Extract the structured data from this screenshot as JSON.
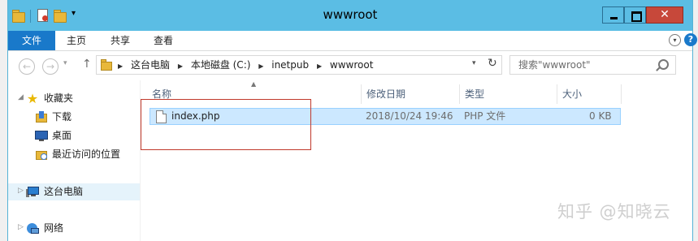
{
  "window": {
    "title": "wwwroot"
  },
  "ribbon": {
    "tabs": [
      {
        "label": "文件"
      },
      {
        "label": "主页"
      },
      {
        "label": "共享"
      },
      {
        "label": "查看"
      }
    ]
  },
  "address_bar": {
    "path": [
      "这台电脑",
      "本地磁盘 (C:)",
      "inetpub",
      "wwwroot"
    ]
  },
  "search": {
    "placeholder": "搜索\"wwwroot\""
  },
  "nav_pane": {
    "items": [
      {
        "label": "收藏夹",
        "icon": "star-icon"
      },
      {
        "label": "下载",
        "icon": "downloads-folder-icon"
      },
      {
        "label": "桌面",
        "icon": "desktop-icon"
      },
      {
        "label": "最近访问的位置",
        "icon": "recent-places-icon"
      },
      {
        "label": "这台电脑",
        "icon": "computer-icon"
      },
      {
        "label": "网络",
        "icon": "network-icon"
      }
    ]
  },
  "file_list": {
    "columns": [
      "名称",
      "修改日期",
      "类型",
      "大小"
    ],
    "rows": [
      {
        "name": "index.php",
        "modified": "2018/10/24 19:46",
        "type": "PHP 文件",
        "size": "0 KB"
      }
    ]
  },
  "watermark": {
    "text": "知乎 @知晓云"
  },
  "colors": {
    "titlebar": "#5bbde4",
    "file_tab": "#1979ca",
    "selection": "#cce8ff",
    "highlight_box": "#c0392b"
  }
}
